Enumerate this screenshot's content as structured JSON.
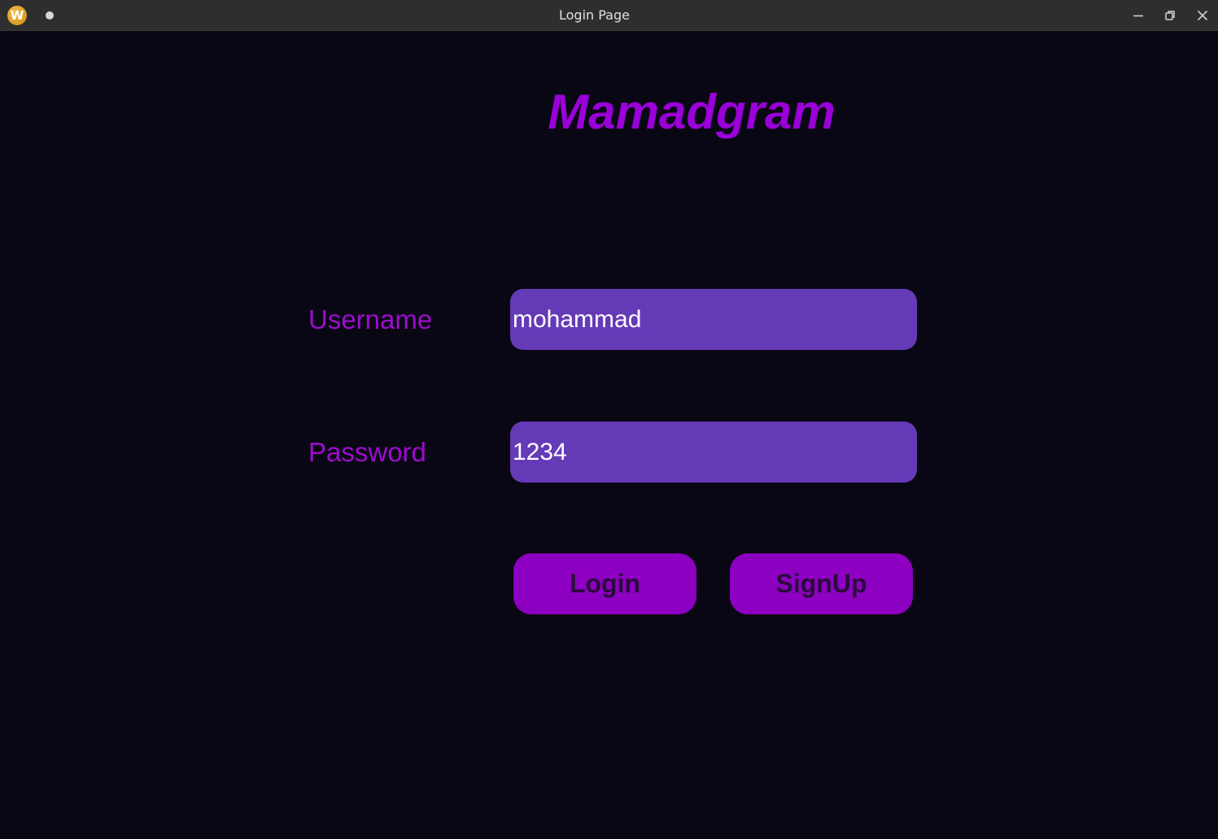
{
  "window": {
    "title": "Login Page",
    "app_icon_letter": "W",
    "app_icon": "app-logo-icon",
    "controls": [
      "minimize-icon",
      "restore-icon",
      "close-icon"
    ]
  },
  "brand": {
    "name": "Mamadgram"
  },
  "form": {
    "username_label": "Username",
    "username_value": "mohammad",
    "password_label": "Password",
    "password_value": "1234"
  },
  "buttons": {
    "login_label": "Login",
    "signup_label": "SignUp"
  },
  "colors": {
    "background": "#090713",
    "titlebar": "#2e2e2e",
    "accent_purple": "#9a00d8",
    "field_bg": "#653ab7",
    "button_bg": "#8d00c2",
    "button_text": "#2a0b3b"
  }
}
